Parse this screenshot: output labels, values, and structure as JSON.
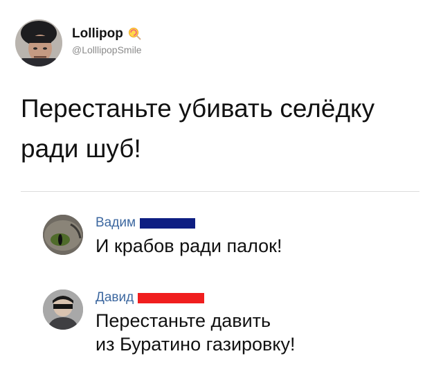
{
  "post": {
    "author_name": "Lollipop",
    "author_handle": "@LolllipopSmile",
    "text_line1": "Перестаньте убивать селёдку",
    "text_line2": "ради шуб!"
  },
  "comments": [
    {
      "name": "Вадим",
      "bar_color": "#0e1e82",
      "text_lines": [
        "И крабов ради палок!"
      ]
    },
    {
      "name": "Давид",
      "bar_color": "#f01e1e",
      "text_lines": [
        "Перестаньте давить",
        "из Буратино газировку!"
      ]
    }
  ],
  "icons": {
    "author_badge": "lollipop-icon"
  },
  "colors": {
    "commenter_name": "#3d68a0",
    "handle": "#8a8a8a"
  }
}
